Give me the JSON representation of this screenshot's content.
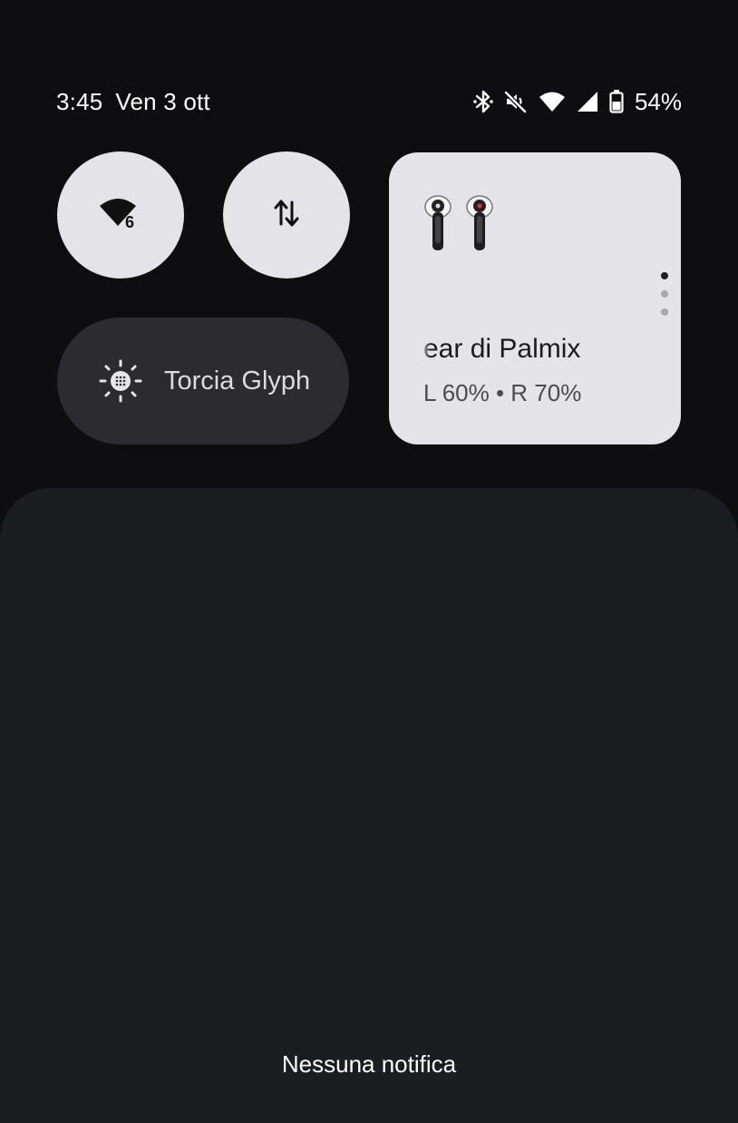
{
  "status_bar": {
    "time": "3:45",
    "date": "Ven 3 ott",
    "battery_percent": "54%",
    "icons": [
      "bluetooth-icon",
      "vibrate-off-icon",
      "wifi-icon",
      "cell-signal-icon",
      "battery-icon"
    ],
    "battery_level": 0.54
  },
  "tiles": {
    "wifi": {
      "icon": "wifi-6-icon",
      "badge": "6"
    },
    "data": {
      "icon": "mobile-data-arrows-icon"
    },
    "torch": {
      "label": "Torcia Glyph",
      "icon": "glyph-torch-icon"
    }
  },
  "earbuds_card": {
    "name": "ear di Palmix",
    "battery": "L 60% • R 70%",
    "pages": 3,
    "active_page": 0
  },
  "notifications": {
    "empty_text": "Nessuna notifica"
  },
  "colors": {
    "background": "#0e0e10",
    "tile_light": "#e3e3e8",
    "tile_dark": "#2c2c30",
    "panel": "#1c1d21"
  }
}
